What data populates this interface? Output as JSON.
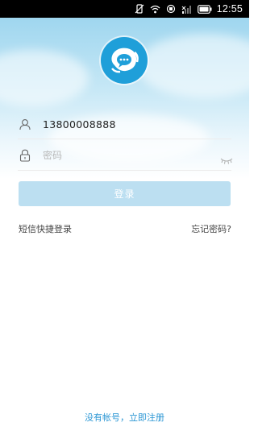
{
  "status_bar": {
    "time": "12:55",
    "icons": [
      "vibrate-off-icon",
      "wifi-icon",
      "data-icon",
      "signal-icon",
      "battery-icon"
    ]
  },
  "login": {
    "logo": "chat-bubble-logo",
    "account_value": "13800008888",
    "password_placeholder": "密码",
    "login_button": "登录",
    "sms_login": "短信快捷登录",
    "forgot_password": "忘记密码?",
    "register_link": "没有帐号，立即注册"
  },
  "colors": {
    "brand": "#1f9fd9",
    "button_disabled": "#bcdff1",
    "link": "#2a96d4"
  }
}
